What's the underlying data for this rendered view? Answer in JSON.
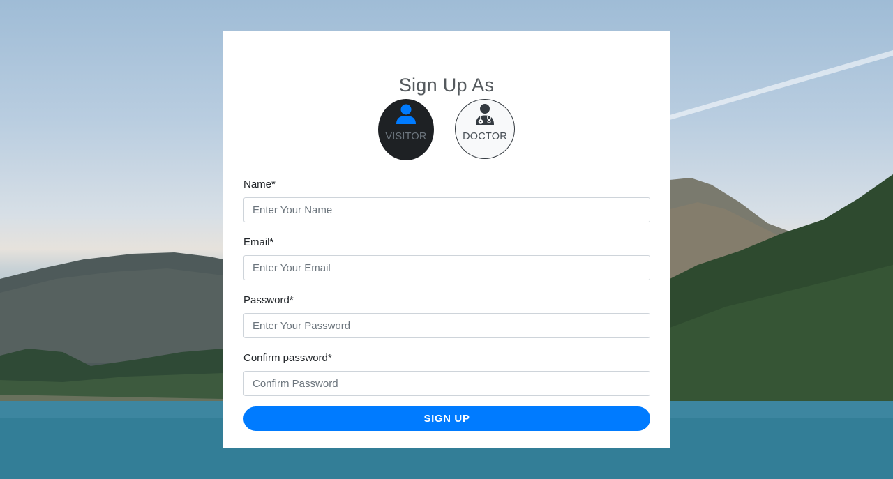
{
  "page": {
    "title": "Sign Up As"
  },
  "roles": [
    {
      "label": "VISITOR",
      "icon": "user-icon",
      "selected": true
    },
    {
      "label": "DOCTOR",
      "icon": "doctor-icon",
      "selected": false
    }
  ],
  "form": {
    "fields": [
      {
        "label": "Name*",
        "placeholder": "Enter Your Name",
        "value": ""
      },
      {
        "label": "Email*",
        "placeholder": "Enter Your Email",
        "value": ""
      },
      {
        "label": "Password*",
        "placeholder": "Enter Your Password",
        "value": ""
      },
      {
        "label": "Confirm password*",
        "placeholder": "Confirm Password",
        "value": ""
      }
    ],
    "submit_label": "SIGN UP"
  },
  "colors": {
    "accent": "#007bff",
    "selected_role_bg": "#1e2124",
    "card_bg": "#ffffff"
  }
}
